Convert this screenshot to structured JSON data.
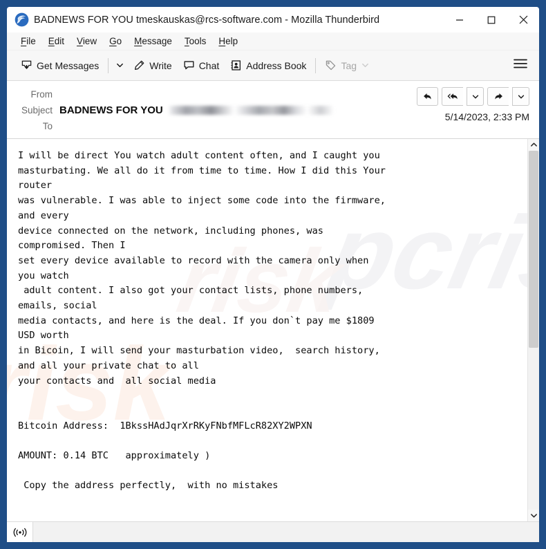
{
  "window": {
    "title": "BADNEWS FOR YOU tmeskauskas@rcs-software.com - Mozilla Thunderbird",
    "logo_icon": "thunderbird-logo-icon",
    "controls": {
      "minimize": "minimize-icon",
      "maximize": "maximize-icon",
      "close": "close-icon"
    },
    "border_color": "#1f4e87"
  },
  "menubar": {
    "items": [
      {
        "pre": "",
        "accel": "F",
        "post": "ile"
      },
      {
        "pre": "",
        "accel": "E",
        "post": "dit"
      },
      {
        "pre": "",
        "accel": "V",
        "post": "iew"
      },
      {
        "pre": "",
        "accel": "G",
        "post": "o"
      },
      {
        "pre": "",
        "accel": "M",
        "post": "essage"
      },
      {
        "pre": "",
        "accel": "T",
        "post": "ools"
      },
      {
        "pre": "",
        "accel": "H",
        "post": "elp"
      }
    ]
  },
  "toolbar": {
    "get_messages_label": "Get Messages",
    "get_messages_icon": "inbox-download-icon",
    "get_messages_caret_icon": "chevron-down-icon",
    "write_label": "Write",
    "write_icon": "pencil-icon",
    "chat_label": "Chat",
    "chat_icon": "speech-bubble-icon",
    "address_book_label": "Address Book",
    "address_book_icon": "address-book-icon",
    "tag_label": "Tag",
    "tag_icon": "tag-icon",
    "tag_caret_icon": "chevron-down-icon",
    "tag_disabled": true,
    "menu_icon": "hamburger-menu-icon"
  },
  "message_header": {
    "from_label": "From",
    "from_value": "",
    "subject_label": "Subject",
    "subject_value": "BADNEWS FOR YOU",
    "subject_redacted": true,
    "to_label": "To",
    "to_value": "",
    "date": "5/14/2023, 2:33 PM",
    "actions": {
      "reply_icon": "reply-icon",
      "reply_all_icon": "reply-all-icon",
      "reply_all_caret_icon": "chevron-down-icon",
      "forward_icon": "forward-arrow-icon",
      "forward_caret_icon": "chevron-down-icon"
    }
  },
  "message_body": {
    "text": "I will be direct You watch adult content often, and I caught you\nmasturbating. We all do it from time to time. How I did this Your\nrouter\nwas vulnerable. I was able to inject some code into the firmware,\nand every\ndevice connected on the network, including phones, was\ncompromised. Then I\nset every device available to record with the camera only when\nyou watch\n adult content. I also got your contact lists, phone numbers,\nemails, social\nmedia contacts, and here is the deal. If you don`t pay me $1809\nUSD worth\nin Bicoin, I will send your masturbation video,  search history,\nand all your private chat to all\nyour contacts and  all social media\n\n\nBitcoin Address:  1BkssHAdJqrXrRKyFNbfMFLcR82XY2WPXN\n\nAMOUNT: 0.14 BTC   approximately )\n\n Copy the address perfectly,  with no mistakes",
    "bitcoin_address": "1BkssHAdJqrXrRKyFNbfMFLcR82XY2WPXN",
    "amount": "0.14 BTC",
    "ransom_usd": "$1809",
    "watermarks": {
      "one": "risk",
      "two": "pcrisk",
      "three": "risk"
    }
  },
  "scrollbar": {
    "up_icon": "chevron-up-icon",
    "down_icon": "chevron-down-icon"
  },
  "statusbar": {
    "connection_icon": "broadcast-online-icon",
    "text": ""
  }
}
